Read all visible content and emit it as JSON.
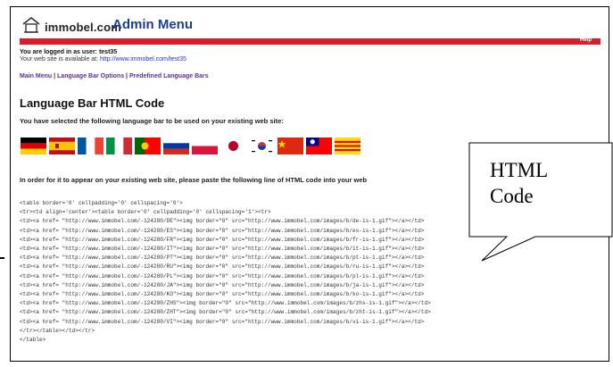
{
  "logo": {
    "text": "immobel.com"
  },
  "header": {
    "title": "Admin Menu",
    "help": "Help"
  },
  "session": {
    "logged_in": "You are logged in as user: test35",
    "website_prefix": "Your web site is available at: ",
    "website_url": "http://www.immobel.com/test35"
  },
  "nav": {
    "main_menu": "Main Menu",
    "sep1": " | ",
    "language_bar_options": "Language Bar Options",
    "sep2": " | ",
    "predefined": "Predefined Language Bars"
  },
  "section": {
    "title": "Language Bar HTML Code",
    "selected_text": "You have selected the following language bar to be used on your existing web site:",
    "instruction": "In order for it to appear on your existing web site, please paste the following line of HTML code into your web"
  },
  "flags": [
    {
      "name": "german-flag"
    },
    {
      "name": "spanish-flag"
    },
    {
      "name": "french-flag"
    },
    {
      "name": "italian-flag"
    },
    {
      "name": "portuguese-flag"
    },
    {
      "name": "russian-flag"
    },
    {
      "name": "polish-flag"
    },
    {
      "name": "japanese-flag"
    },
    {
      "name": "korean-flag"
    },
    {
      "name": "chinese-flag"
    },
    {
      "name": "taiwanese-flag"
    },
    {
      "name": "catalan-flag"
    }
  ],
  "code_lines": [
    "<table border='0' cellpadding='0' cellspacing='0'>",
    "<tr><td align='center'><table border='0' cellpadding='0' cellspacing='1'><tr>",
    "<td><a href= \"http://www.immobel.com/-124280/DE\"><img border=\"0\" src=\"http://www.immobel.com/images/b/de-is-1.gif\"></a></td>",
    "<td><a href= \"http://www.immobel.com/-124280/ES\"><img border=\"0\" src=\"http://www.immobel.com/images/b/es-is-1.gif\"></a></td>",
    "<td><a href= \"http://www.immobel.com/-124280/FR\"><img border=\"0\" src=\"http://www.immobel.com/images/b/fr-is-1.gif\"></a></td>",
    "<td><a href= \"http://www.immobel.com/-124280/IT\"><img border=\"0\" src=\"http://www.immobel.com/images/b/it-is-1.gif\"></a></td>",
    "<td><a href= \"http://www.immobel.com/-124280/PT\"><img border=\"0\" src=\"http://www.immobel.com/images/b/pt-is-1.gif\"></a></td>",
    "<td><a href= \"http://www.immobel.com/-124280/RU\"><img border=\"0\" src=\"http://www.immobel.com/images/b/ru-is-1.gif\"></a></td>",
    "<td><a href= \"http://www.immobel.com/-124280/PL\"><img border=\"0\" src=\"http://www.immobel.com/images/b/pl-is-1.gif\"></a></td>",
    "<td><a href= \"http://www.immobel.com/-124280/JA\"><img border=\"0\" src=\"http://www.immobel.com/images/b/ja-is-1.gif\"></a></td>",
    "<td><a href= \"http://www.immobel.com/-124280/KO\"><img border=\"0\" src=\"http://www.immobel.com/images/b/ko-is-1.gif\"></a></td>",
    "<td><a href= \"http://www.immobel.com/-124280/ZHS\"><img border=\"0\" src=\"http://www.immobel.com/images/b/zhs-is-1.gif\"></a></td>",
    "<td><a href= \"http://www.immobel.com/-124280/ZHT\"><img border=\"0\" src=\"http://www.immobel.com/images/b/zht-is-1.gif\"></a></td>",
    "<td><a href= \"http://www.immobel.com/-124280/VI\"><img border=\"0\" src=\"http://www.immobel.com/images/b/vi-is-1.gif\"></a></td>",
    "</tr></table></td></tr>",
    "</table>"
  ],
  "callout": {
    "line1": "HTML",
    "line2": "Code"
  },
  "colors": {
    "red_bar": "#d61f2a",
    "title_blue": "#1f3d8a",
    "link_purple": "#5a2f9a",
    "link_blue": "#2233cc"
  }
}
